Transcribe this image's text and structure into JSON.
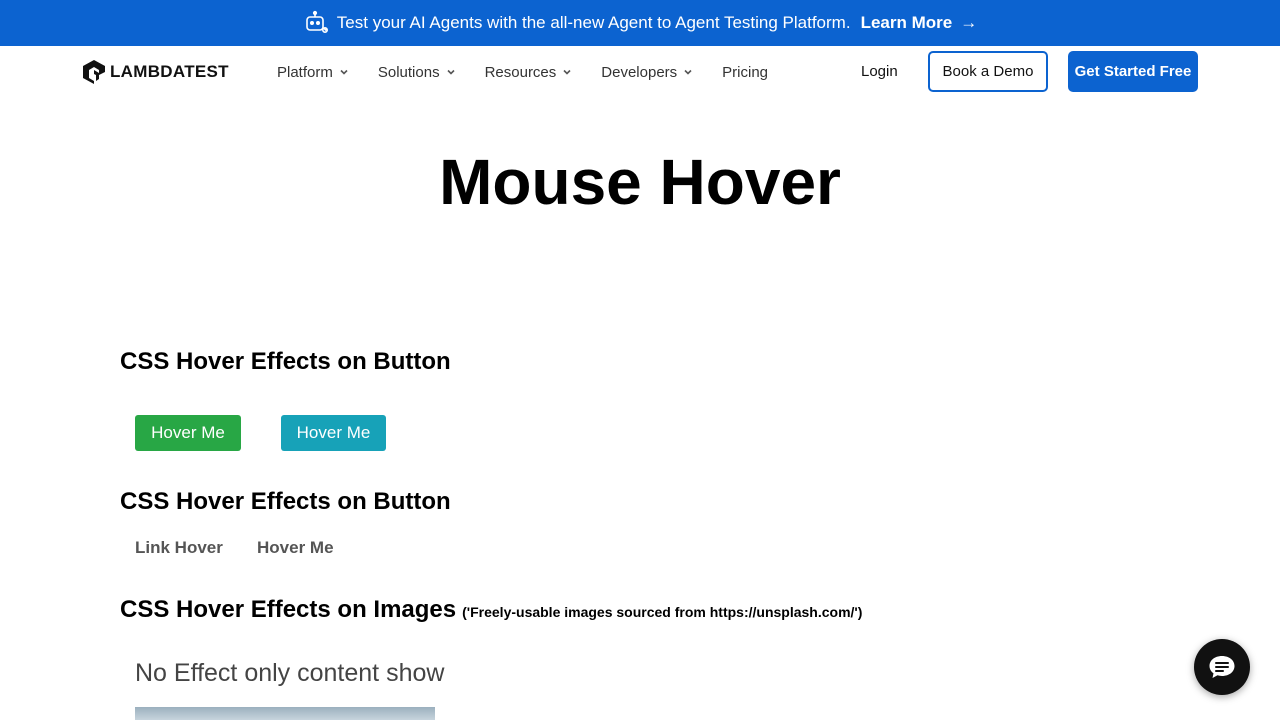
{
  "banner": {
    "message": "Test your AI Agents with the all-new Agent to Agent Testing Platform.",
    "link_label": "Learn More",
    "arrow": "→",
    "icon": "robot-icon"
  },
  "nav": {
    "logo_text": "LAMBDATEST",
    "items": [
      {
        "label": "Platform",
        "dropdown": true
      },
      {
        "label": "Solutions",
        "dropdown": true
      },
      {
        "label": "Resources",
        "dropdown": true
      },
      {
        "label": "Developers",
        "dropdown": true
      },
      {
        "label": "Pricing",
        "dropdown": false
      }
    ],
    "login": "Login",
    "book_demo": "Book a Demo",
    "get_started": "Get Started Free"
  },
  "page": {
    "title": "Mouse Hover"
  },
  "sections": {
    "button_effects_1": {
      "title": "CSS Hover Effects on Button",
      "buttons": [
        "Hover Me",
        "Hover Me"
      ]
    },
    "button_effects_2": {
      "title": "CSS Hover Effects on Button",
      "links": [
        "Link Hover",
        "Hover Me"
      ]
    },
    "image_effects": {
      "title": "CSS Hover Effects on Images",
      "note": "('Freely-usable images sourced from https://unsplash.com/')",
      "caption": "No Effect only content show"
    }
  },
  "colors": {
    "brand_blue": "#0c63d0",
    "green": "#28a745",
    "teal": "#17a2b8"
  },
  "chat": {
    "icon": "chat-icon"
  }
}
